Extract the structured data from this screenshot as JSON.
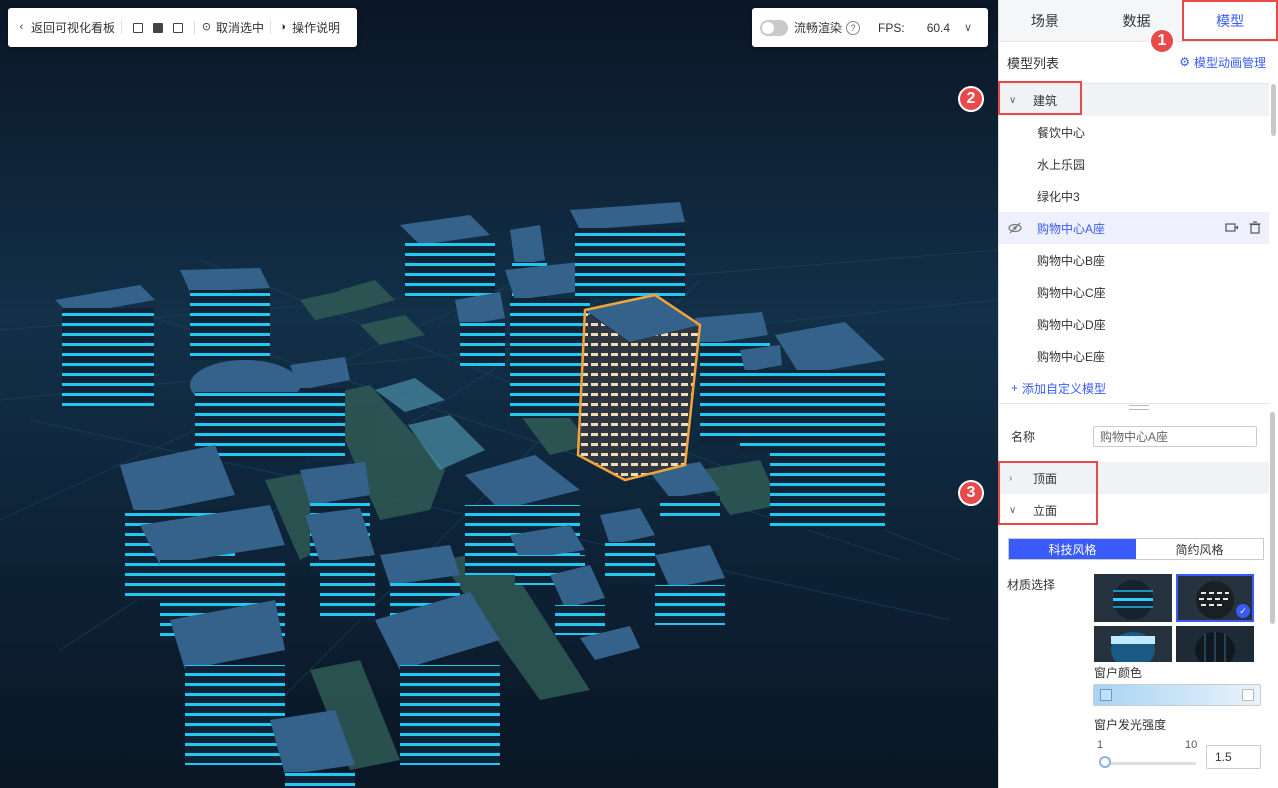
{
  "toolbar": {
    "back_label": "返回可视化看板",
    "cancel_select_label": "取消选中",
    "help_label": "操作说明"
  },
  "render": {
    "smooth_label": "流畅渲染",
    "smooth_on": false,
    "fps_label": "FPS:",
    "fps_value": "60.4"
  },
  "tabs": [
    {
      "label": "场景",
      "active": false
    },
    {
      "label": "数据",
      "active": false
    },
    {
      "label": "模型",
      "active": true
    }
  ],
  "model_list": {
    "title": "模型列表",
    "anim_manage_label": "模型动画管理",
    "group_label": "建筑",
    "items": [
      "餐饮中心",
      "水上乐园",
      "绿化中3",
      "购物中心A座",
      "购物中心B座",
      "购物中心C座",
      "购物中心D座",
      "购物中心E座"
    ],
    "selected_index": 3,
    "add_label": "添加自定义模型"
  },
  "props": {
    "name_label": "名称",
    "name_value": "购物中心A座",
    "top_label": "顶面",
    "facade_label": "立面",
    "style_tech": "科技风格",
    "style_simple": "简约风格",
    "material_label": "材质选择",
    "window_color_label": "窗户颜色",
    "window_glow_label": "窗户发光强度",
    "slider_min": "1",
    "slider_max": "10",
    "glow_value": "1.5"
  },
  "callouts": [
    "1",
    "2",
    "3"
  ],
  "colors": {
    "accent": "#3a5bfb",
    "highlight": "#e84a4a",
    "building_top": "#2f5a80",
    "glow": "#28d6ff",
    "selection": "#f2a33a"
  }
}
